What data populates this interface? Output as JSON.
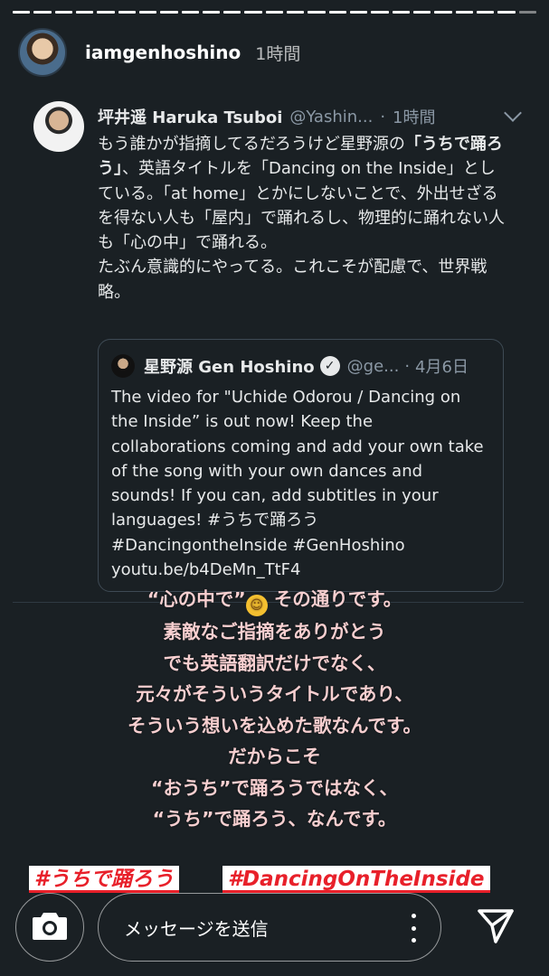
{
  "story": {
    "segments": 25,
    "viewed_segments": 24,
    "username": "iamgenhoshino",
    "time": "1時間"
  },
  "tweet": {
    "name": "坪井遥 Haruka Tsuboi",
    "handle": "@Yashin...",
    "dot": "·",
    "time": "1時間",
    "body_1": "もう誰かが指摘してるだろうけど星野源の",
    "body_bold": "「うちで踊ろう」",
    "body_2": "、英語タイトルを「Dancing on the Inside」としている。「at home」とかにしないことで、外出せざるを得ない人も「屋内」で踊れるし、物理的に踊れない人も「心の中」で踊れる。",
    "body_3": "たぶん意識的にやってる。これこそが配慮で、世界戦略。",
    "quote": {
      "name": "星野源 Gen Hoshino",
      "verified_mark": "✓",
      "handle": "@ge...",
      "dot": "·",
      "date": "4月6日",
      "body": "The video for \"Uchide Odorou / Dancing on the Inside” is out now! Keep the collaborations coming and add your own take of the song with your own dances and sounds! If you can, add subtitles in your languages! #うちで踊ろう #DancingontheInside #GenHoshino youtu.be/b4DeMn_TtF4"
    }
  },
  "caption": {
    "line1_a": "“心の中で”",
    "line1_emoji": "☺",
    "line1_b": "その通りです。",
    "line2": "素敵なご指摘をありがとう",
    "line3": "でも英語翻訳だけでなく、",
    "line4": "元々がそういうタイトルであり、",
    "line5": "そういう想いを込めた歌なんです。",
    "line6": "だからこそ",
    "line7": "“おうち”で踊ろうではなく、",
    "line8": "“うち”で踊ろう、なんです。"
  },
  "hashtags": [
    "#うちで踊ろう",
    "#DancingOnTheInside"
  ],
  "footer": {
    "message_placeholder": "メッセージを送信"
  },
  "colors": {
    "background": "#1a2024",
    "caption_text": "#f7cfd0",
    "hashtag_red": "#e8202a"
  },
  "icons": [
    "camera-icon",
    "more-icon",
    "send-icon",
    "verified-icon",
    "chevron-down-icon"
  ]
}
